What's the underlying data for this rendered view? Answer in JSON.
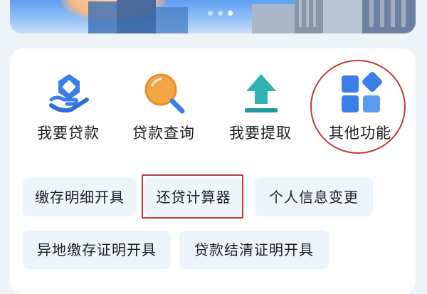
{
  "banner": {
    "slide_count": 3,
    "active_slide": 3
  },
  "quick_actions": [
    {
      "label": "我要贷款",
      "icon": "loan-hand-icon"
    },
    {
      "label": "贷款查询",
      "icon": "magnifier-icon"
    },
    {
      "label": "我要提取",
      "icon": "upload-arrow-icon"
    },
    {
      "label": "其他功能",
      "icon": "grid-apps-icon"
    }
  ],
  "services": [
    {
      "label": "缴存明细开具"
    },
    {
      "label": "还贷计算器"
    },
    {
      "label": "个人信息变更"
    },
    {
      "label": "异地缴存证明开具"
    },
    {
      "label": "贷款结清证明开具"
    }
  ],
  "colors": {
    "accent_blue": "#3a7ee8",
    "highlight_red": "#c03a3a",
    "chip_bg": "#eef4fb",
    "page_bg": "#eef3f8"
  }
}
